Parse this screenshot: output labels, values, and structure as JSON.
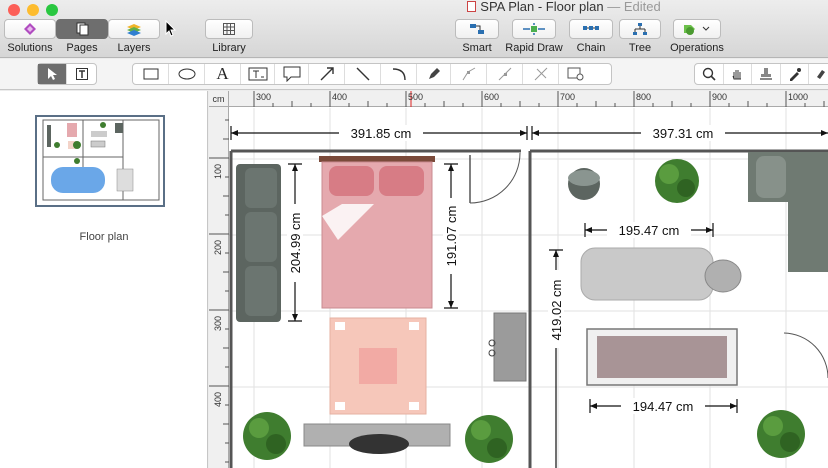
{
  "window": {
    "title": "SPA Plan - Floor plan",
    "edited": "— Edited"
  },
  "toolbar_left": [
    {
      "label": "Solutions",
      "icon": "solutions-icon"
    },
    {
      "label": "Pages",
      "icon": "pages-icon"
    },
    {
      "label": "Layers",
      "icon": "layers-icon"
    }
  ],
  "library": {
    "label": "Library",
    "icon": "library-icon"
  },
  "toolbar_right": [
    {
      "label": "Smart",
      "icon": "smart-icon"
    },
    {
      "label": "Rapid Draw",
      "icon": "rapid-draw-icon"
    },
    {
      "label": "Chain",
      "icon": "chain-icon"
    },
    {
      "label": "Tree",
      "icon": "tree-icon"
    },
    {
      "label": "Operations",
      "icon": "operations-icon"
    }
  ],
  "drawing_tools": [
    "select-arrow",
    "text-box",
    "rectangle",
    "ellipse",
    "text",
    "text-field",
    "callout",
    "arrow",
    "line",
    "arc",
    "pen",
    "smart-connector",
    "spline",
    "connector-edit",
    "insert-image"
  ],
  "view_tools": [
    "zoom",
    "pan",
    "stamp",
    "eyedropper",
    "format-painter"
  ],
  "sidebar": {
    "page_label": "Floor plan"
  },
  "ruler": {
    "unit": "cm",
    "h_ticks": [
      "300",
      "400",
      "500",
      "600",
      "700",
      "800",
      "900",
      "1000"
    ],
    "v_ticks": [
      "100",
      "200",
      "300",
      "400"
    ]
  },
  "dimensions": {
    "room_left_width": "391.85 cm",
    "room_right_width": "397.31 cm",
    "sofa_length": "204.99 cm",
    "bed_length": "191.07 cm",
    "room_height": "419.02 cm",
    "table_width": "195.47 cm",
    "rug_width": "194.47 cm"
  },
  "colors": {
    "bed": "#e5a9ae",
    "sofa": "#5c6560",
    "plant": "#3f7d2f",
    "wall": "#555555",
    "table": "#c9c9c9"
  }
}
